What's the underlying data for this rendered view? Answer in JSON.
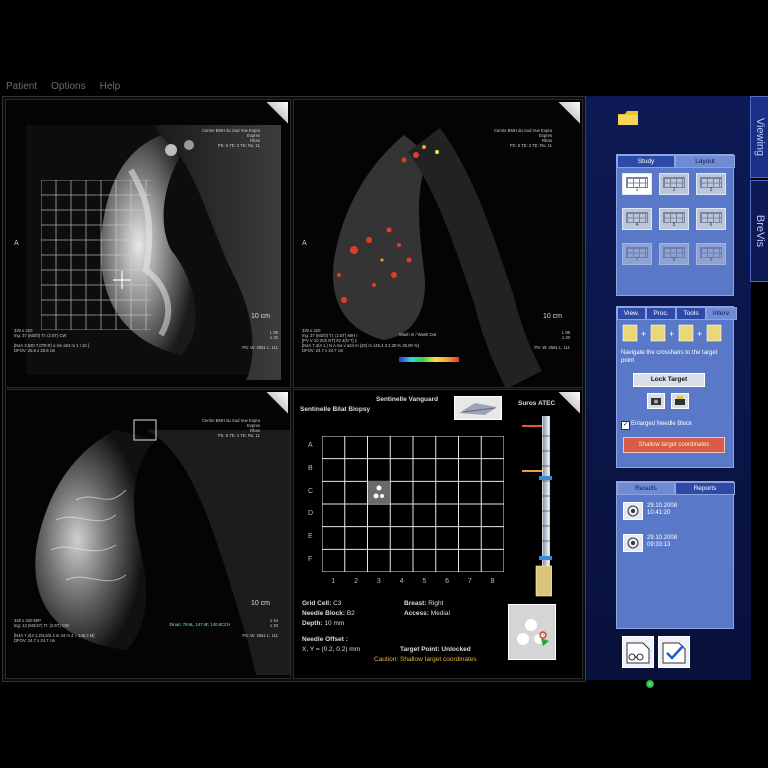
{
  "menu": {
    "items": [
      "Patient",
      "Options",
      "Help"
    ]
  },
  "panes": {
    "top_left": {
      "header": [
        "Centre BMH du Sud Vue Expra",
        "Expres",
        "Rhao",
        "PS: 6 TE: 2 TE: Ru: 11"
      ],
      "scale": "10 cm",
      "side_letter": "A",
      "footer_left": [
        "320 x 320",
        "Ing: 37 (M2/0) TI: (2.5T) CW",
        "",
        "[N4A 3,620 7,070 R) a mv a24 m 1 I 10 ]",
        "DFOV: 25.6 x 25.6 cm"
      ],
      "footer_right": [
        "L 88",
        "1 20",
        "PS: W: 2561 L: 111"
      ]
    },
    "top_right": {
      "header": [
        "Centre BMH du Sud Vue Expra",
        "Expres",
        "Rhao",
        "PS: 6 TE: 2 TE: Ru: 11"
      ],
      "scale": "10 cm",
      "side_letter": "A",
      "footer_center": "Wash In / Wash Out",
      "footer_left": [
        "320 x 320",
        "Ing: 37 (M2/0) TI: (2.5T) MIH I",
        "[PV V 10 2Ck NT] #2 4(N T] 1",
        "[N4A 7,4(4 1,) N A ma v a24 m (20) m 145,4 3 2.30 % 25.00 %)",
        "DFOV: 24.7 x 24.7 cm"
      ],
      "footer_right": [
        "L 88",
        "1 20",
        "PS: W: 2561 L: 111"
      ]
    },
    "bottom_left": {
      "header": [
        "Centre BMH du Sud Vue Expra",
        "Expres",
        "Rhao",
        "PS: 6 TE: 2 TE: Ru: 11"
      ],
      "scale": "10 cm",
      "footer_left": [
        "320 x 320 MIP",
        "Ing: 12 (M2/47) TI: (2.5T) CW",
        "",
        "[N4A 7,4(4 1,2/4,6/2.4 m 44 m 4 = 146,3 M]",
        "DFOV: 24.7 x 24.7 cm"
      ],
      "footer_right": [
        "1 44",
        "1 20",
        "PS: W: 2561 L: 111"
      ],
      "footer_right_mid": "Dinan: 79.9L, 147.4F, 140.6CCH"
    },
    "planning": {
      "title": "Sentinelle Vanguard",
      "subtitle": "Sentinelle Bilat Biopsy",
      "device_label": "Suros ATEC",
      "rows": [
        "A",
        "B",
        "C",
        "D",
        "E",
        "F"
      ],
      "cols": [
        "1",
        "2",
        "3",
        "4",
        "5",
        "6",
        "7",
        "8"
      ],
      "target_cell": "C3",
      "info_left": [
        {
          "label": "Grid Cell:",
          "value": "C3"
        },
        {
          "label": "Needle Block:",
          "value": "B2"
        },
        {
          "label": "Depth:",
          "value": "10 mm"
        }
      ],
      "info_right": [
        {
          "label": "Breast:",
          "value": "Right"
        },
        {
          "label": "Access:",
          "value": "Medial"
        }
      ],
      "needle_offset_label": "Needle Offset :",
      "needle_offset_value": "X, Y = (0.2, 0.2) mm",
      "target_point": "Target Point: Unlocked",
      "caution": "Caution: Shallow target coordinates"
    }
  },
  "sidebar": {
    "vertical_tabs": [
      "Viewing",
      "BreVis"
    ],
    "top_tabs": [
      "Study",
      "Layout"
    ],
    "active_top_tab": "Layout",
    "layouts": [
      "1",
      "2",
      "3",
      "4",
      "5",
      "6",
      "7",
      "8",
      "9"
    ],
    "mid_tabs": [
      "View.",
      "Proc.",
      "Tools",
      "Interv."
    ],
    "active_mid_tab": "Interv.",
    "instructions": "Navigate the crosshairs to the target point",
    "lock_target_label": "Lock Target",
    "enlarged_block_label": "Enlarged Needle Block",
    "enlarged_block_checked": true,
    "warning_button_label": "Shallow target coordinates",
    "results_tabs": [
      "Results",
      "Reports"
    ],
    "active_results_tab": "Results",
    "results": [
      {
        "date": "29.10.2008",
        "time": "10:41:20"
      },
      {
        "date": "29.10.2008",
        "time": "09:33:13"
      }
    ],
    "accent_color": "#5a78c8",
    "panel_color": "#0d1a55"
  }
}
